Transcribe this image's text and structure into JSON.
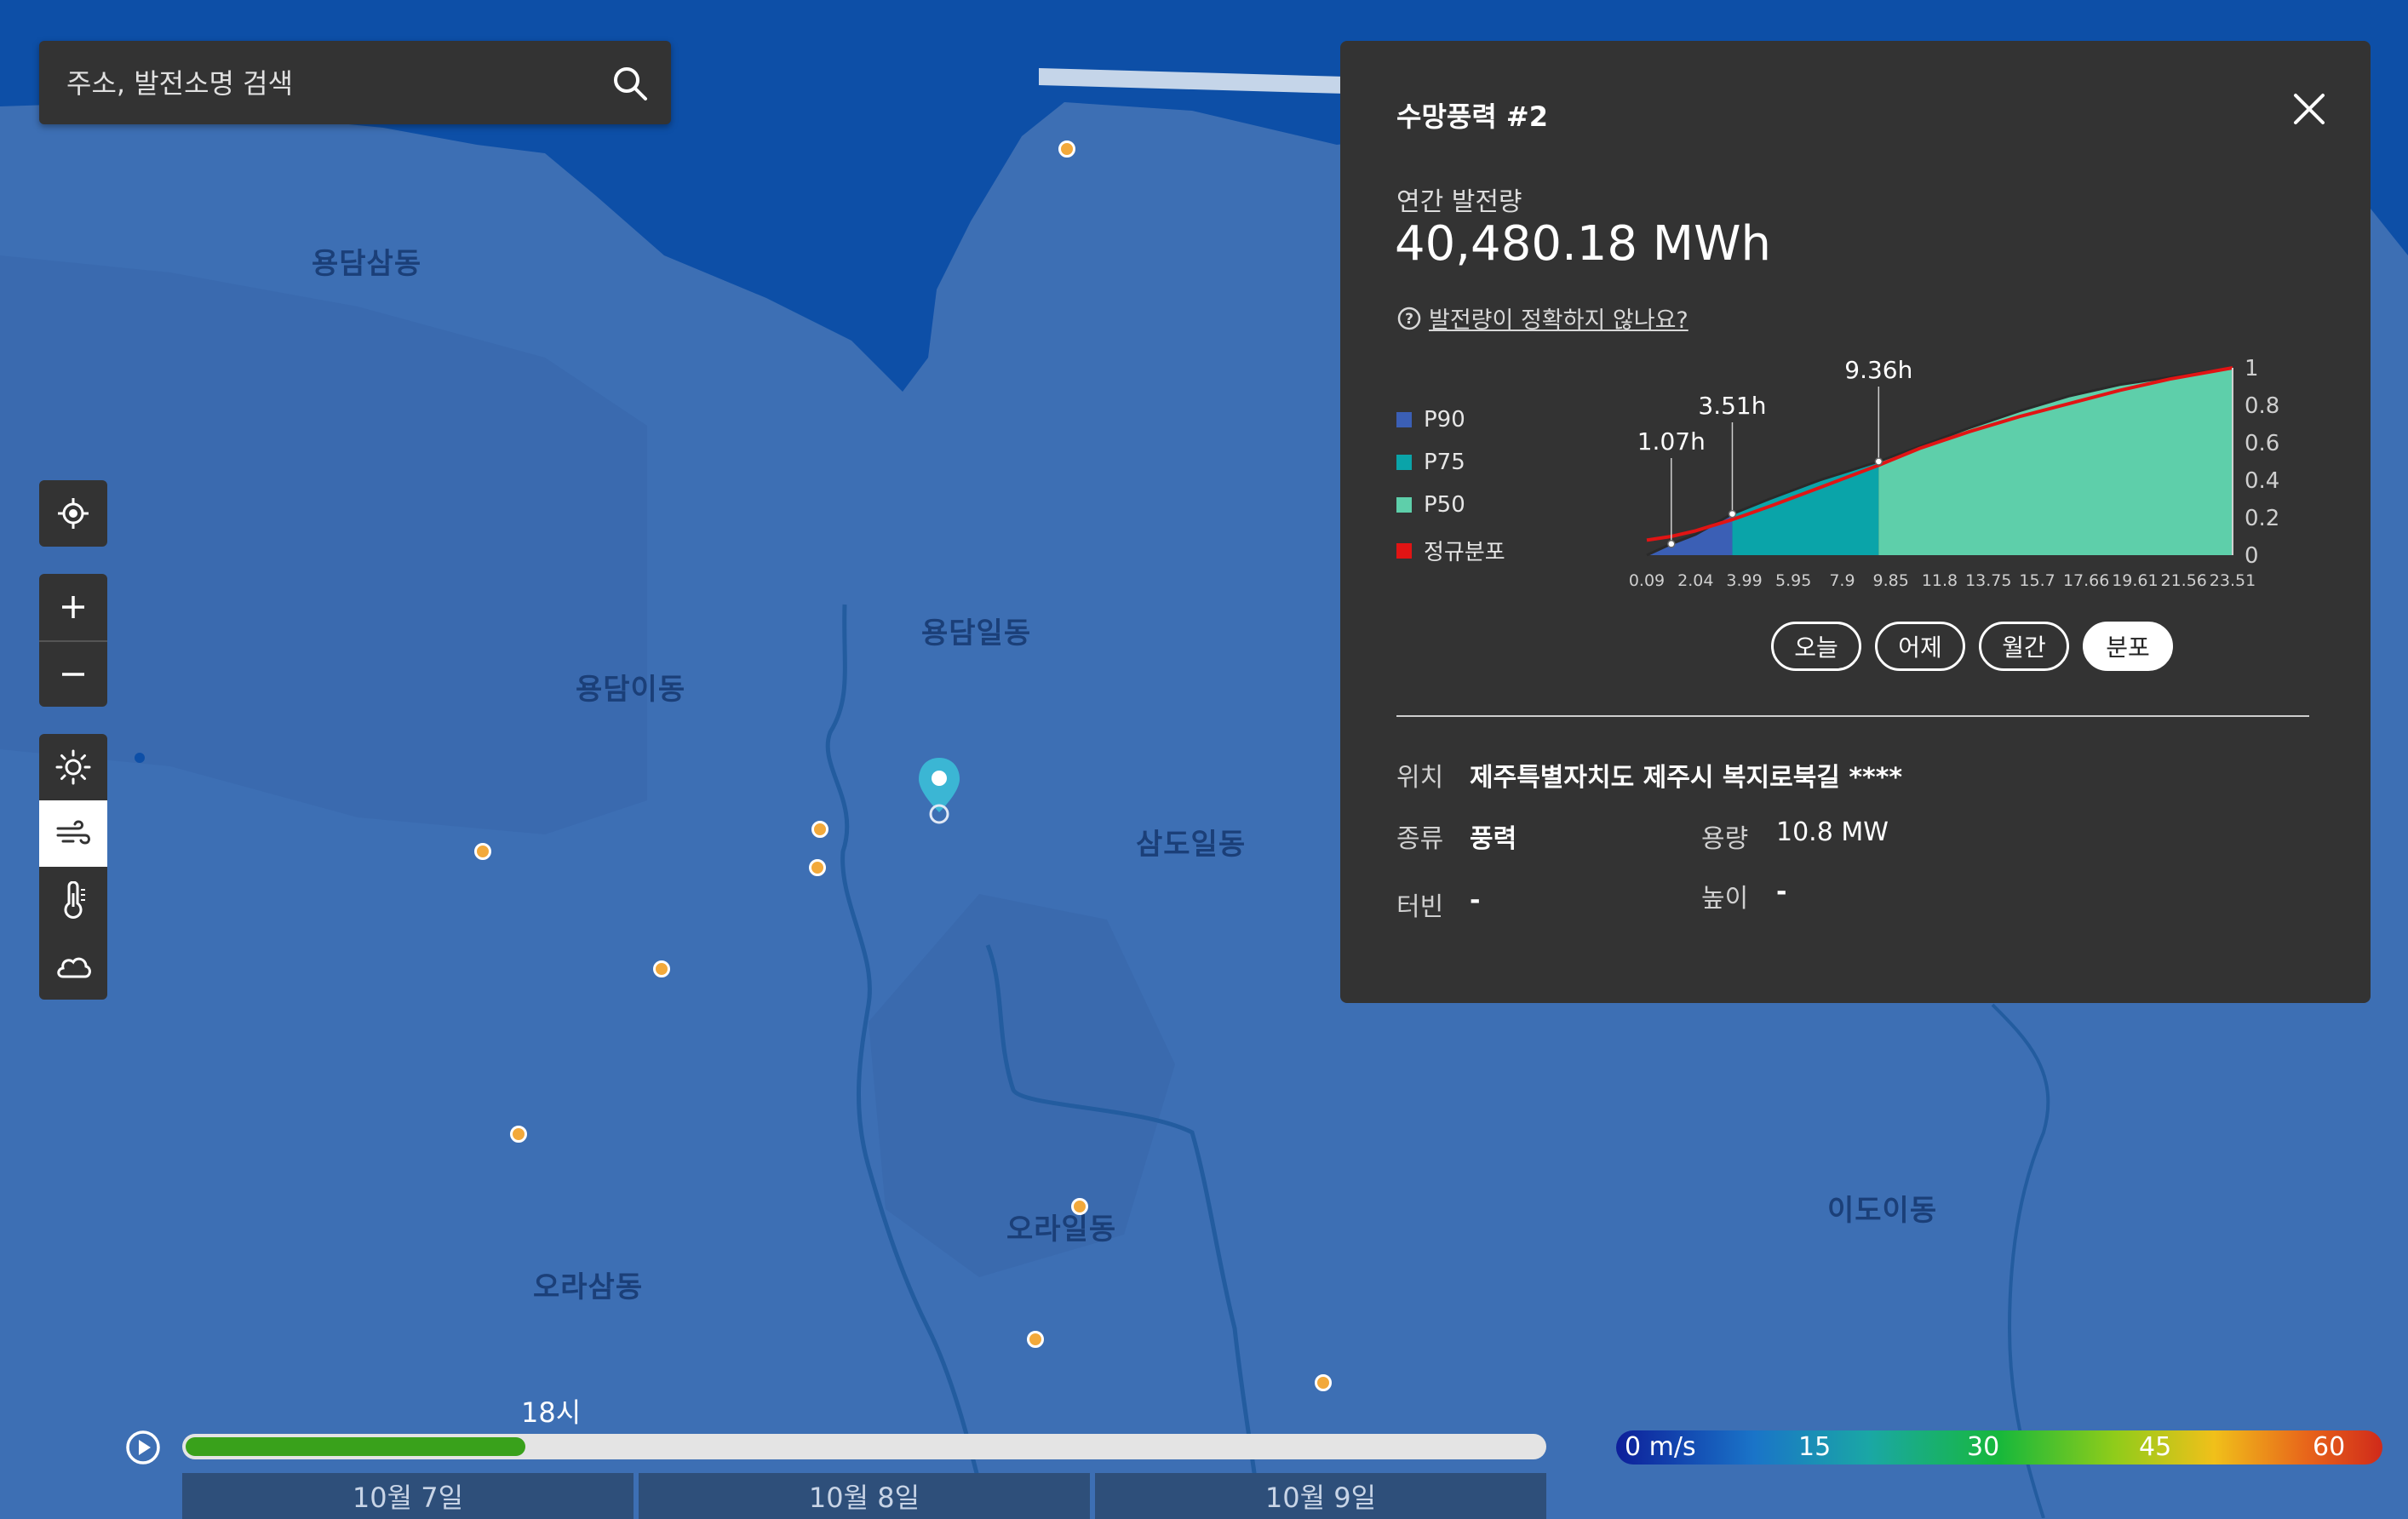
{
  "search": {
    "placeholder": "주소, 발전소명 검색"
  },
  "icons": {
    "search": "search-icon",
    "locate": "crosshair-icon",
    "zoom_in": "plus-icon",
    "zoom_out": "minus-icon",
    "sun": "sun-icon",
    "wind": "wind-icon",
    "temperature": "thermometer-icon",
    "cloud": "cloud-icon",
    "close": "close-icon",
    "help": "question-circle-icon",
    "play": "play-icon",
    "pin": "map-pin-icon"
  },
  "layers": {
    "active": "wind"
  },
  "map": {
    "districts": [
      "용담삼동",
      "용담이동",
      "용담일동",
      "삼도일동",
      "오라일동",
      "오라삼동",
      "이도이동"
    ]
  },
  "panel": {
    "title": "수망풍력 #2",
    "annual_label": "연간 발전량",
    "annual_value": "40,480.18 MWh",
    "accuracy_link": "발전량이 정확하지 않나요?",
    "legend": [
      {
        "label": "P90",
        "color": "#3b5fb5"
      },
      {
        "label": "P75",
        "color": "#0aa4a9"
      },
      {
        "label": "P50",
        "color": "#5ecfaa"
      },
      {
        "label": "정규분포",
        "color": "#e11414"
      }
    ],
    "tabs": [
      "오늘",
      "어제",
      "월간",
      "분포"
    ],
    "active_tab": "분포",
    "info": {
      "location_label": "위치",
      "location_value": "제주특별자치도 제주시 복지로북길 ****",
      "type_label": "종류",
      "type_value": "풍력",
      "capacity_label": "용량",
      "capacity_value": "10.8 MW",
      "turbine_label": "터빈",
      "turbine_value": "-",
      "height_label": "높이",
      "height_value": "-"
    }
  },
  "chart_data": {
    "type": "area",
    "x_ticks": [
      "0.09",
      "2.04",
      "3.99",
      "5.95",
      "7.9",
      "9.85",
      "11.8",
      "13.75",
      "15.7",
      "17.66",
      "19.61",
      "21.56",
      "23.51"
    ],
    "y_ticks": [
      "1",
      "0.8",
      "0.6",
      "0.4",
      "0.2",
      "0"
    ],
    "xlim": [
      0.09,
      23.51
    ],
    "ylim": [
      0,
      1
    ],
    "annotations": [
      {
        "label": "1.07h",
        "x": 1.07,
        "y": 0.06
      },
      {
        "label": "3.51h",
        "x": 3.51,
        "y": 0.22
      },
      {
        "label": "9.36h",
        "x": 9.36,
        "y": 0.5
      }
    ],
    "series": [
      {
        "name": "P90",
        "range": [
          0.09,
          3.51
        ]
      },
      {
        "name": "P75",
        "range": [
          3.51,
          9.36
        ]
      },
      {
        "name": "P50",
        "range": [
          9.36,
          23.51
        ]
      },
      {
        "name": "정규분포"
      }
    ],
    "distribution": {
      "x": [
        0.09,
        1.07,
        2.04,
        3.51,
        5.0,
        7.0,
        9.36,
        11.0,
        13.0,
        15.0,
        17.0,
        19.0,
        21.0,
        23.51
      ],
      "y": [
        0.0,
        0.06,
        0.11,
        0.22,
        0.3,
        0.4,
        0.5,
        0.58,
        0.68,
        0.77,
        0.85,
        0.91,
        0.95,
        1.0
      ]
    },
    "normal": {
      "x": [
        0.09,
        1.07,
        2.04,
        3.51,
        5.0,
        7.0,
        9.36,
        11.0,
        13.0,
        15.0,
        17.0,
        19.0,
        21.0,
        23.51
      ],
      "y": [
        0.08,
        0.1,
        0.13,
        0.19,
        0.26,
        0.36,
        0.48,
        0.57,
        0.66,
        0.74,
        0.81,
        0.88,
        0.94,
        1.0
      ]
    }
  },
  "timeline": {
    "time_label": "18시",
    "progress": 0.25,
    "days": [
      "10월 7일",
      "10월 8일",
      "10월 9일"
    ]
  },
  "wind_scale": {
    "labels": [
      "0 m/s",
      "15",
      "30",
      "45",
      "60"
    ]
  }
}
